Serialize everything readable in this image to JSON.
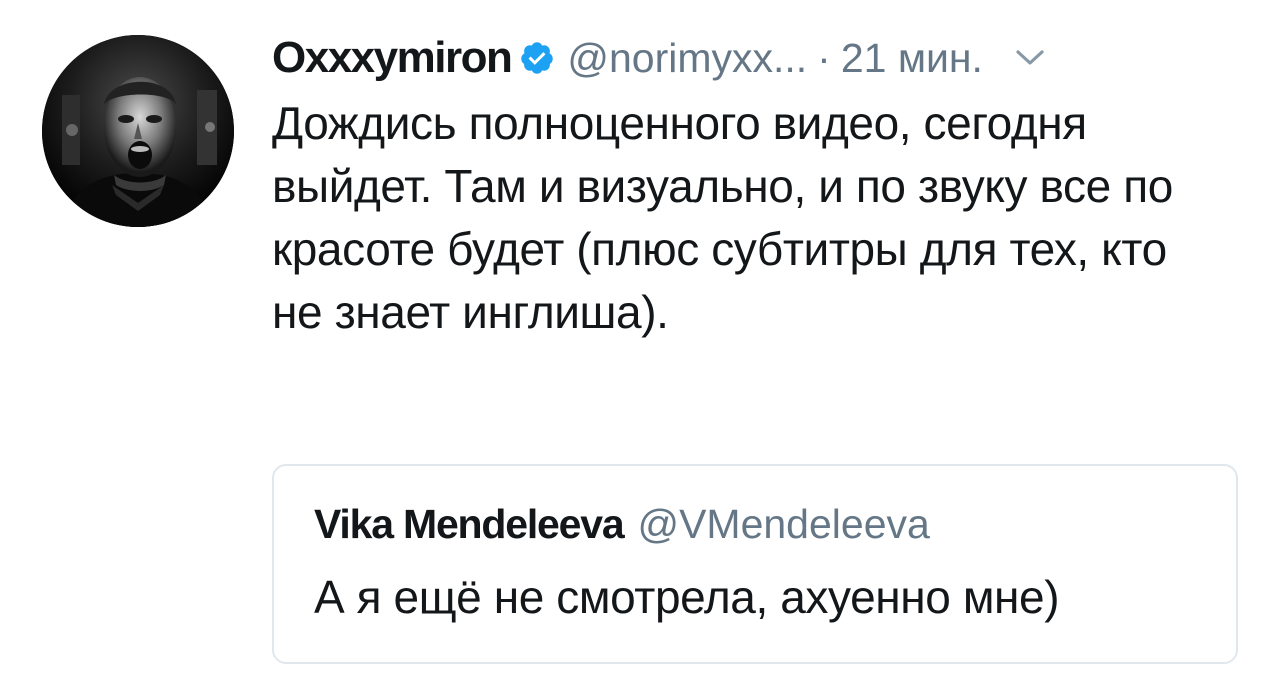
{
  "tweet": {
    "author_name": "Oxxxymiron",
    "author_handle": "@norimyxx...",
    "separator": "·",
    "time": "21 мин.",
    "verified_icon": "verified-badge-icon",
    "menu_icon": "chevron-down-icon",
    "text": "Дождись полноценного видео, сегодня выйдет. Там и визуально, и по звуку все по красоте будет (плюс субтитры для тех, кто не знает инглиша)."
  },
  "quote": {
    "author_name": "Vika Mendeleeva",
    "author_handle": "@VMendeleeva",
    "text": "А я ещё не смотрела, ахуенно мне)"
  },
  "colors": {
    "text_primary": "#14171a",
    "text_secondary": "#657786",
    "verified_blue": "#1da1f2",
    "border": "#e1e8ed"
  }
}
